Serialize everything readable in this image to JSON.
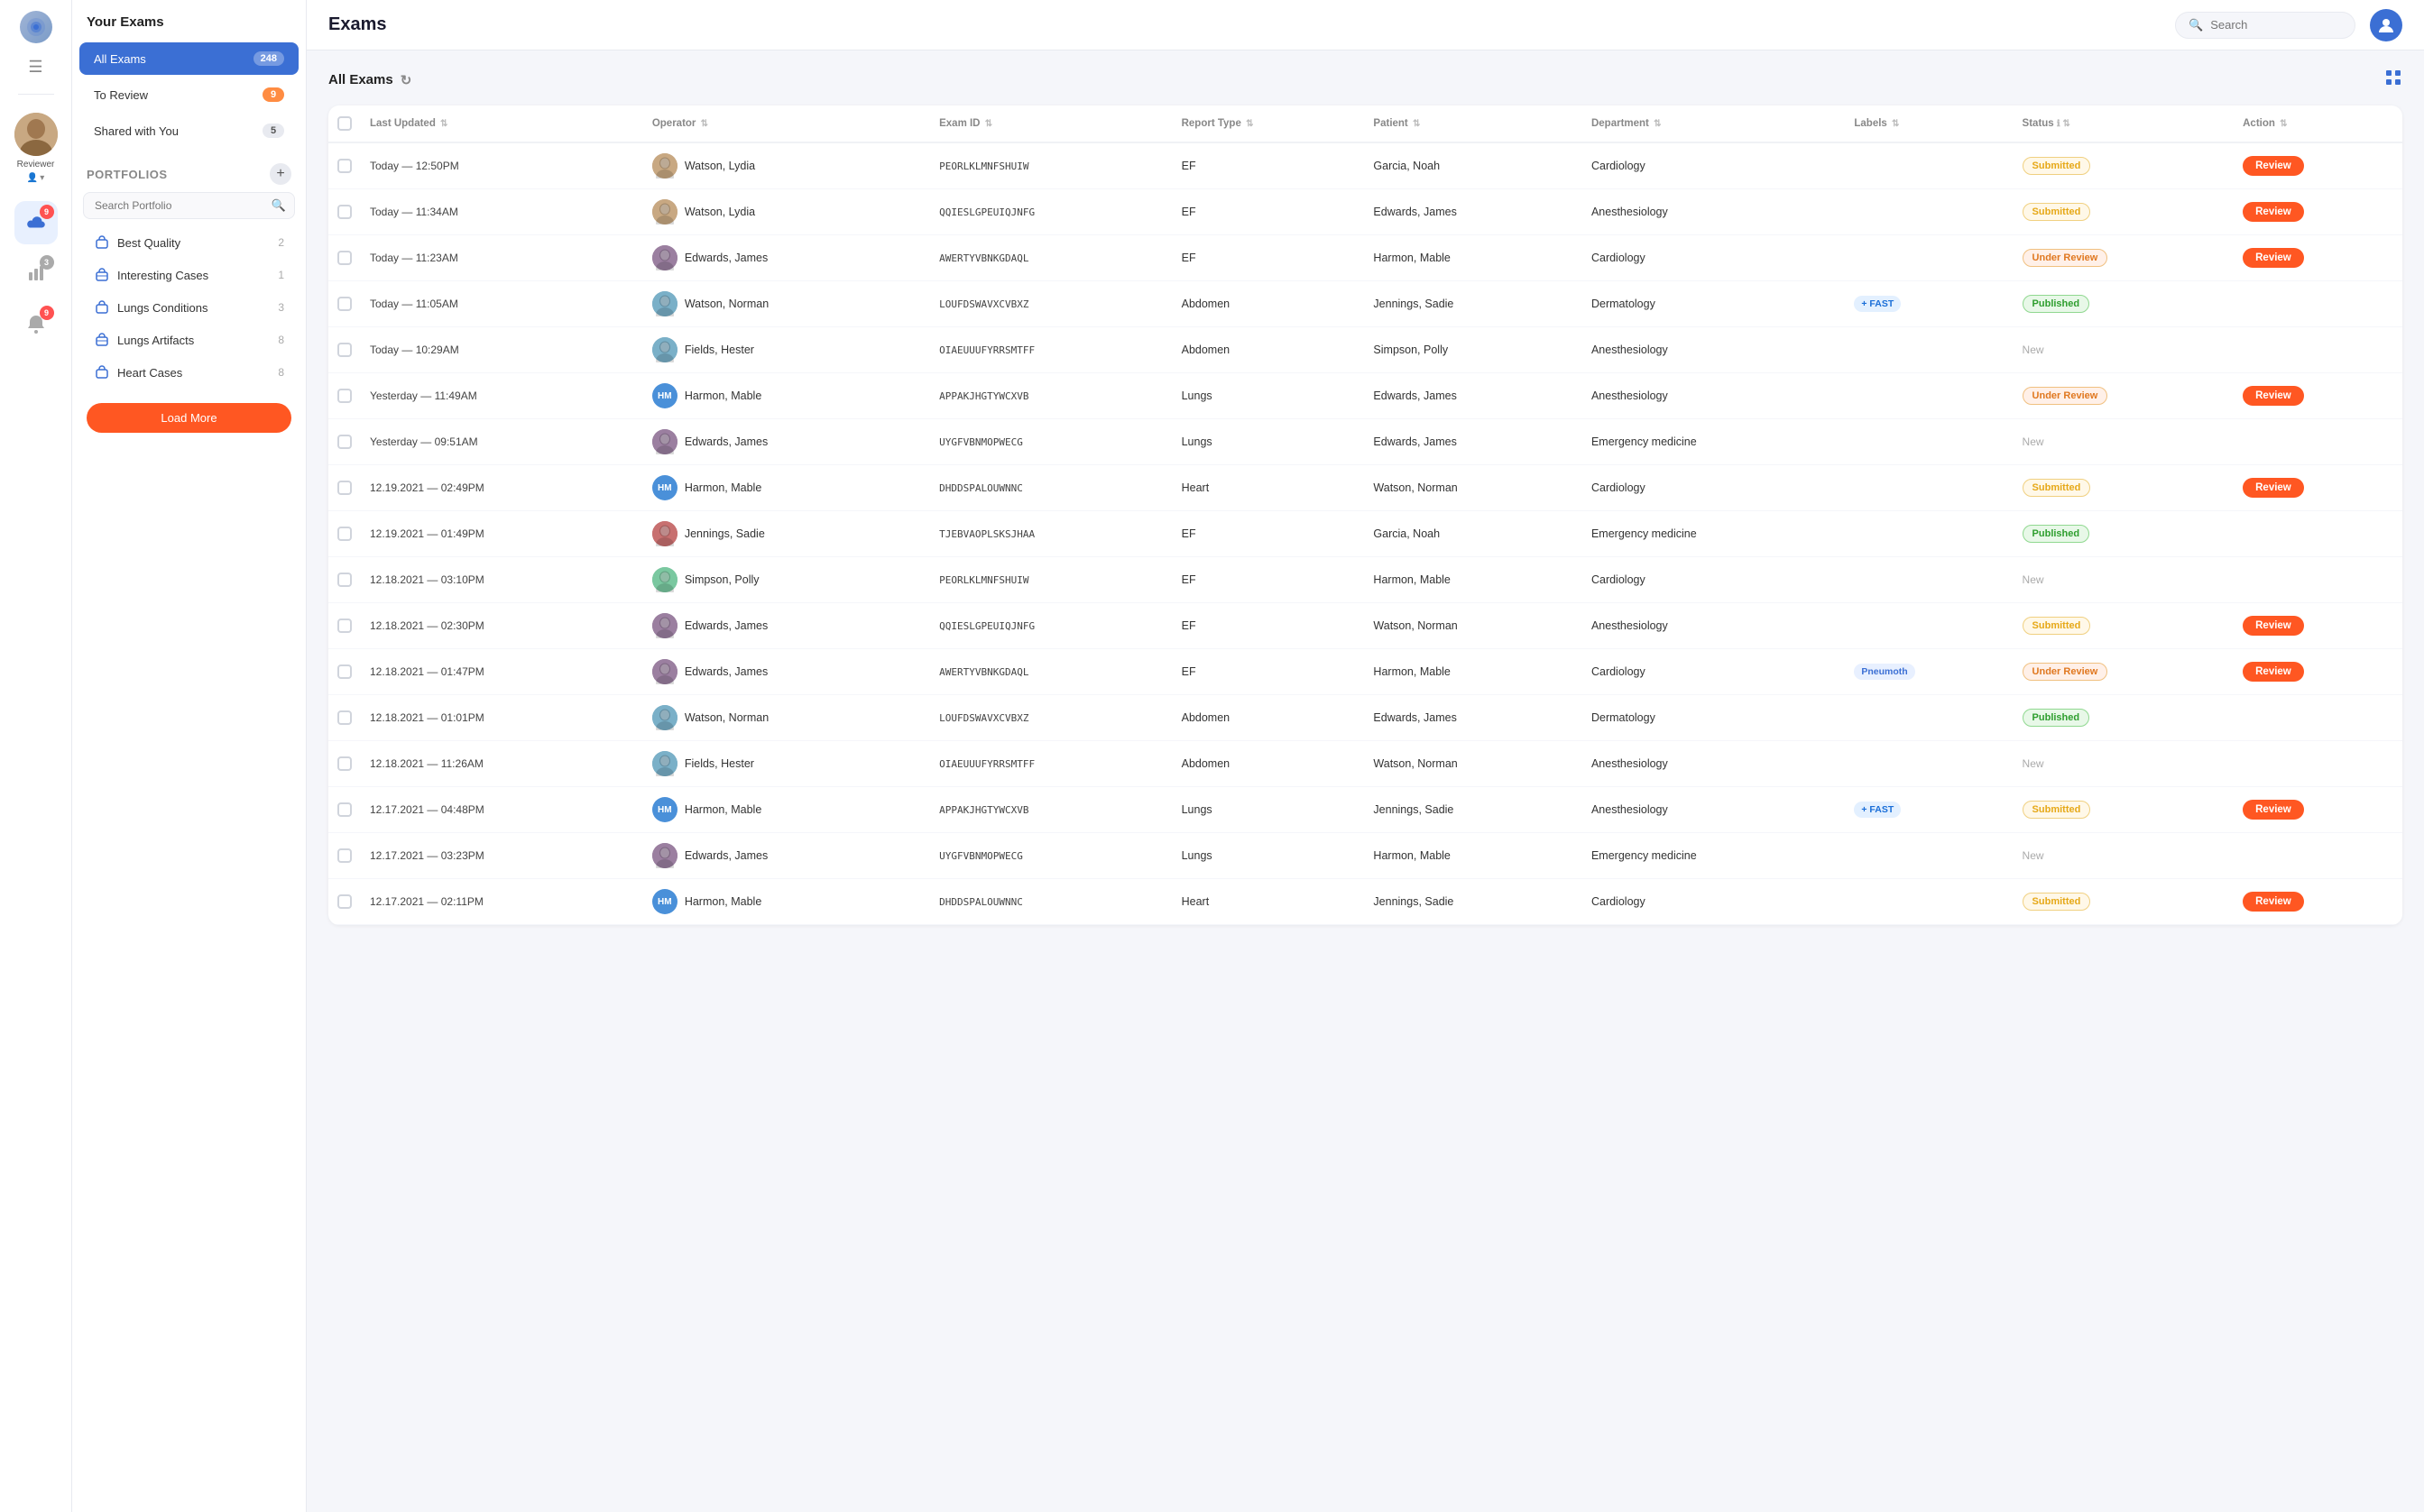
{
  "app": {
    "title": "Exams",
    "search_placeholder": "Search"
  },
  "icon_sidebar": {
    "menu_icon": "☰",
    "notification_badge": "9",
    "chart_badge": "3",
    "bell_badge": "9"
  },
  "reviewer": {
    "name": "Reviewer"
  },
  "left_panel": {
    "your_exams_title": "Your Exams",
    "nav_items": [
      {
        "label": "All Exams",
        "badge": "248",
        "active": true
      },
      {
        "label": "To Review",
        "badge": "9",
        "badge_orange": true
      },
      {
        "label": "Shared with You",
        "badge": "5"
      }
    ],
    "portfolios_title": "Portfolios",
    "search_placeholder": "Search Portfolio",
    "portfolio_items": [
      {
        "label": "Best Quality",
        "count": "2",
        "icon": "briefcase"
      },
      {
        "label": "Interesting Cases",
        "count": "1",
        "icon": "briefcase-outline"
      },
      {
        "label": "Lungs Conditions",
        "count": "3",
        "icon": "briefcase"
      },
      {
        "label": "Lungs Artifacts",
        "count": "8",
        "icon": "briefcase-outline"
      },
      {
        "label": "Heart Cases",
        "count": "8",
        "icon": "briefcase"
      }
    ],
    "load_more": "Load More"
  },
  "table": {
    "section_title": "All Exams",
    "columns": [
      "Last Updated",
      "Operator",
      "Exam ID",
      "Report Type",
      "Patient",
      "Department",
      "Labels",
      "Status",
      "Action"
    ],
    "rows": [
      {
        "date": "Today — 12:50PM",
        "operator": "Watson, Lydia",
        "op_type": "photo",
        "op_color": "#c8a882",
        "exam_id": "PEORLKLMNFSHUIW",
        "report_type": "EF",
        "patient": "Garcia, Noah",
        "department": "Cardiology",
        "labels": "",
        "status": "Submitted",
        "status_class": "submitted",
        "action": "Review"
      },
      {
        "date": "Today — 11:34AM",
        "operator": "Watson, Lydia",
        "op_type": "photo",
        "op_color": "#c8a882",
        "exam_id": "QQIESLGPEUIQJNFG",
        "report_type": "EF",
        "patient": "Edwards, James",
        "department": "Anesthesiology",
        "labels": "",
        "status": "Submitted",
        "status_class": "submitted",
        "action": "Review"
      },
      {
        "date": "Today — 11:23AM",
        "operator": "Edwards, James",
        "op_type": "photo",
        "op_color": "#9b7fa0",
        "exam_id": "AWERTYVBNKGDAQL",
        "report_type": "EF",
        "patient": "Harmon, Mable",
        "department": "Cardiology",
        "labels": "",
        "status": "Under Review",
        "status_class": "under-review",
        "action": "Review"
      },
      {
        "date": "Today — 11:05AM",
        "operator": "Watson, Norman",
        "op_type": "photo",
        "op_color": "#7ab0c8",
        "exam_id": "LOUFDSWAVXCVBXZ",
        "report_type": "Abdomen",
        "patient": "Jennings, Sadie",
        "department": "Dermatology",
        "labels": "+ FAST",
        "labels_class": "fast",
        "status": "Published",
        "status_class": "published",
        "action": ""
      },
      {
        "date": "Today — 10:29AM",
        "operator": "Fields, Hester",
        "op_type": "photo",
        "op_color": "#7ab0c8",
        "exam_id": "OIAEUUUFYRRSMTFF",
        "report_type": "Abdomen",
        "patient": "Simpson, Polly",
        "department": "Anesthesiology",
        "labels": "",
        "status": "New",
        "status_class": "new",
        "action": ""
      },
      {
        "date": "Yesterday — 11:49AM",
        "operator": "Harmon, Mable",
        "op_type": "initials",
        "op_initials": "HM",
        "op_color": "#4a90d9",
        "exam_id": "APPAKJHGTYWCXVB",
        "report_type": "Lungs",
        "patient": "Edwards, James",
        "department": "Anesthesiology",
        "labels": "",
        "status": "Under Review",
        "status_class": "under-review",
        "action": "Review"
      },
      {
        "date": "Yesterday — 09:51AM",
        "operator": "Edwards, James",
        "op_type": "photo",
        "op_color": "#9b7fa0",
        "exam_id": "UYGFVBNMOPWECG",
        "report_type": "Lungs",
        "patient": "Edwards, James",
        "department": "Emergency medicine",
        "labels": "",
        "status": "New",
        "status_class": "new",
        "action": ""
      },
      {
        "date": "12.19.2021 — 02:49PM",
        "operator": "Harmon, Mable",
        "op_type": "initials",
        "op_initials": "HM",
        "op_color": "#4a90d9",
        "exam_id": "DHDDSPALOUWNNC",
        "report_type": "Heart",
        "patient": "Watson, Norman",
        "department": "Cardiology",
        "labels": "",
        "status": "Submitted",
        "status_class": "submitted",
        "action": "Review"
      },
      {
        "date": "12.19.2021 — 01:49PM",
        "operator": "Jennings, Sadie",
        "op_type": "photo",
        "op_color": "#c87070",
        "exam_id": "TJEBVAOPLSKSJHAA",
        "report_type": "EF",
        "patient": "Garcia, Noah",
        "department": "Emergency medicine",
        "labels": "",
        "status": "Published",
        "status_class": "published",
        "action": ""
      },
      {
        "date": "12.18.2021 — 03:10PM",
        "operator": "Simpson, Polly",
        "op_type": "photo",
        "op_color": "#7ac8a0",
        "exam_id": "PEORLKLMNFSHUIW",
        "report_type": "EF",
        "patient": "Harmon, Mable",
        "department": "Cardiology",
        "labels": "",
        "status": "New",
        "status_class": "new",
        "action": ""
      },
      {
        "date": "12.18.2021 — 02:30PM",
        "operator": "Edwards, James",
        "op_type": "photo",
        "op_color": "#9b7fa0",
        "exam_id": "QQIESLGPEUIQJNFG",
        "report_type": "EF",
        "patient": "Watson, Norman",
        "department": "Anesthesiology",
        "labels": "",
        "status": "Submitted",
        "status_class": "submitted",
        "action": "Review"
      },
      {
        "date": "12.18.2021 — 01:47PM",
        "operator": "Edwards, James",
        "op_type": "photo",
        "op_color": "#9b7fa0",
        "exam_id": "AWERTYVBNKGDAQL",
        "report_type": "EF",
        "patient": "Harmon, Mable",
        "department": "Cardiology",
        "labels": "Pneumoth",
        "labels_class": "pneumo",
        "status": "Under Review",
        "status_class": "under-review",
        "action": "Review"
      },
      {
        "date": "12.18.2021 — 01:01PM",
        "operator": "Watson, Norman",
        "op_type": "photo",
        "op_color": "#7ab0c8",
        "exam_id": "LOUFDSWAVXCVBXZ",
        "report_type": "Abdomen",
        "patient": "Edwards, James",
        "department": "Dermatology",
        "labels": "",
        "status": "Published",
        "status_class": "published",
        "action": ""
      },
      {
        "date": "12.18.2021 — 11:26AM",
        "operator": "Fields, Hester",
        "op_type": "photo",
        "op_color": "#7ab0c8",
        "exam_id": "OIAEUUUFYRRSMTFF",
        "report_type": "Abdomen",
        "patient": "Watson, Norman",
        "department": "Anesthesiology",
        "labels": "",
        "status": "New",
        "status_class": "new",
        "action": ""
      },
      {
        "date": "12.17.2021 — 04:48PM",
        "operator": "Harmon, Mable",
        "op_type": "initials",
        "op_initials": "HM",
        "op_color": "#4a90d9",
        "exam_id": "APPAKJHGTYWCXVB",
        "report_type": "Lungs",
        "patient": "Jennings, Sadie",
        "department": "Anesthesiology",
        "labels": "+ FAST",
        "labels_class": "fast",
        "status": "Submitted",
        "status_class": "submitted",
        "action": "Review"
      },
      {
        "date": "12.17.2021 — 03:23PM",
        "operator": "Edwards, James",
        "op_type": "photo",
        "op_color": "#9b7fa0",
        "exam_id": "UYGFVBNMOPWECG",
        "report_type": "Lungs",
        "patient": "Harmon, Mable",
        "department": "Emergency medicine",
        "labels": "",
        "status": "New",
        "status_class": "new",
        "action": ""
      },
      {
        "date": "12.17.2021 — 02:11PM",
        "operator": "Harmon, Mable",
        "op_type": "initials",
        "op_initials": "HM",
        "op_color": "#4a90d9",
        "exam_id": "DHDDSPALOUWNNC",
        "report_type": "Heart",
        "patient": "Jennings, Sadie",
        "department": "Cardiology",
        "labels": "",
        "status": "Submitted",
        "status_class": "submitted",
        "action": "Review"
      }
    ]
  }
}
